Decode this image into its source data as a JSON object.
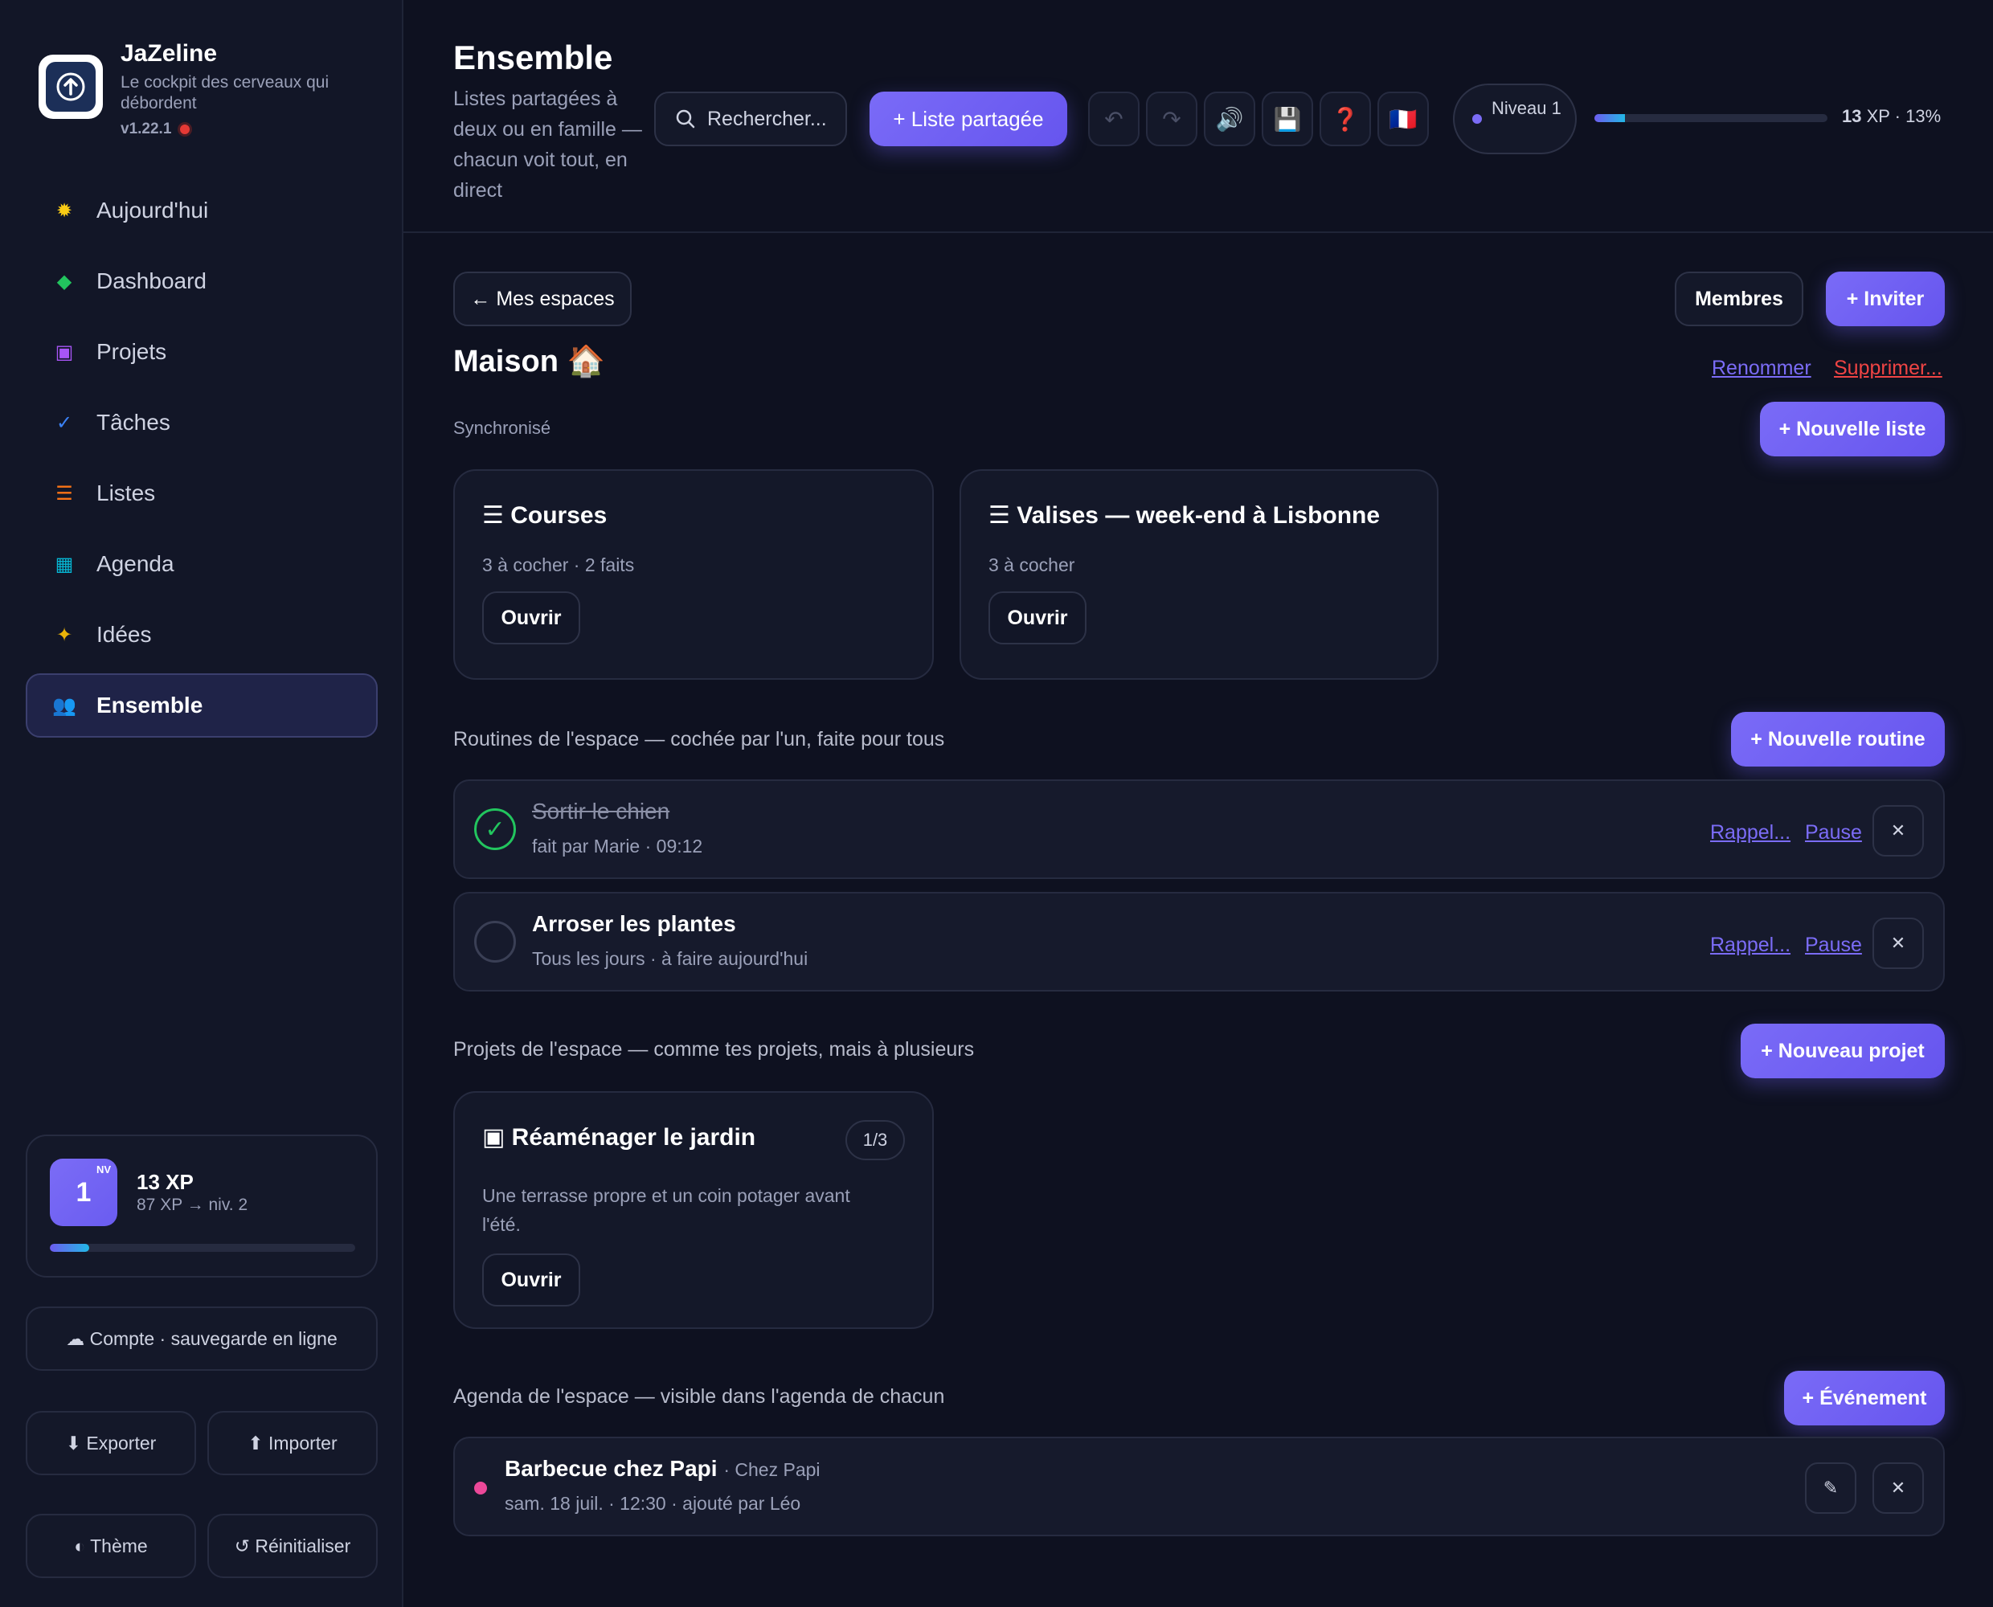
{
  "app": {
    "name": "JaZeline",
    "tagline": "Le cockpit des cerveaux qui débordent",
    "version": "v1.22.1"
  },
  "nav": [
    {
      "label": "Aujourd'hui",
      "icon": "sun-icon",
      "glyph": "✹",
      "color": "#facc15"
    },
    {
      "label": "Dashboard",
      "icon": "diamond-icon",
      "glyph": "◆",
      "color": "#22c55e"
    },
    {
      "label": "Projets",
      "icon": "project-icon",
      "glyph": "▣",
      "color": "#a855f7"
    },
    {
      "label": "Tâches",
      "icon": "check-icon",
      "glyph": "✓",
      "color": "#3b82f6"
    },
    {
      "label": "Listes",
      "icon": "list-icon",
      "glyph": "☰",
      "color": "#f97316"
    },
    {
      "label": "Agenda",
      "icon": "calendar-icon",
      "glyph": "▦",
      "color": "#06b6d4"
    },
    {
      "label": "Idées",
      "icon": "sparkle-icon",
      "glyph": "✦",
      "color": "#eab308"
    },
    {
      "label": "Ensemble",
      "icon": "people-icon",
      "glyph": "👥",
      "color": "#ec4899",
      "active": true
    }
  ],
  "xp_card": {
    "level": "1",
    "level_tag": "NV",
    "xp": "13 XP",
    "next": "87 XP → niv. 2",
    "progress": 0.13
  },
  "sidebar_buttons": {
    "account": "☁ Compte · sauvegarde en ligne",
    "export": "⬇ Exporter",
    "import": "⬆ Importer",
    "theme": "◐ Thème",
    "reset": "↺ Réinitialiser"
  },
  "header": {
    "title": "Ensemble",
    "subtitle": "Listes partagées à deux ou en famille — chacun voit tout, en direct",
    "search_placeholder": "Rechercher...",
    "new_shared": "+  Liste partagée",
    "tools": {
      "undo": "↶",
      "redo": "↷",
      "sound": "🔊",
      "save": "💾",
      "help": "❓",
      "lang": "🇫🇷"
    },
    "level_label": "Niveau 1",
    "xp_value": "13",
    "xp_unit": "XP · 13%",
    "xp_progress": 0.13
  },
  "space": {
    "back": "← Mes espaces",
    "members": "Membres",
    "invite": "+ Inviter",
    "name": "Maison 🏠",
    "rename": "Renommer",
    "delete": "Supprimer...",
    "status": "Synchronisé",
    "new_list": "+ Nouvelle liste"
  },
  "lists": [
    {
      "title": "☰ Courses",
      "meta": "3 à cocher · 2 faits",
      "open": "Ouvrir"
    },
    {
      "title": "☰ Valises — week-end à Lisbonne",
      "meta": "3 à cocher",
      "open": "Ouvrir"
    }
  ],
  "routines": {
    "label": "Routines de l'espace — cochée par l'un, faite pour tous",
    "new": "+ Nouvelle routine",
    "items": [
      {
        "title": "Sortir le chien",
        "sub": "fait par Marie · 09:12",
        "done": true,
        "reminder": "Rappel...",
        "pause": "Pause",
        "close": "✕"
      },
      {
        "title": "Arroser les plantes",
        "sub": "Tous les jours · à faire aujourd'hui",
        "done": false,
        "reminder": "Rappel...",
        "pause": "Pause",
        "close": "✕"
      }
    ]
  },
  "projects": {
    "label": "Projets de l'espace — comme tes projets, mais à plusieurs",
    "new": "+ Nouveau projet",
    "items": [
      {
        "title": "▣ Réaménager le jardin",
        "badge": "1/3",
        "desc": "Une terrasse propre et un coin potager avant l'été.",
        "open": "Ouvrir"
      }
    ]
  },
  "agenda": {
    "label": "Agenda de l'espace — visible dans l'agenda de chacun",
    "new": "+ Événement",
    "items": [
      {
        "title": "Barbecue chez Papi",
        "place": "· Chez Papi",
        "meta": "sam. 18 juil. · 12:30 · ajouté par Léo",
        "edit": "✎",
        "close": "✕",
        "color": "#ec4899"
      }
    ]
  }
}
